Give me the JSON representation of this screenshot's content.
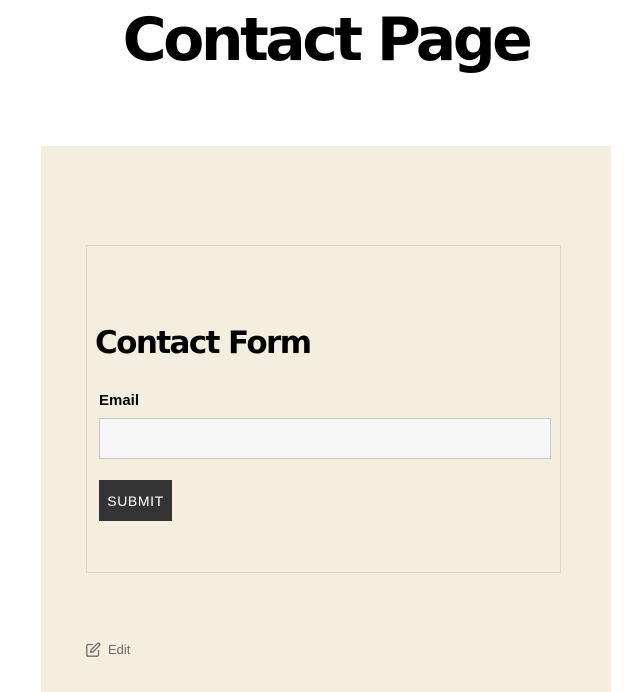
{
  "page": {
    "title": "Contact Page"
  },
  "contact_form": {
    "title": "Contact Form",
    "email_label": "Email",
    "email_value": "",
    "email_placeholder": "",
    "submit_label": "SUBMIT"
  },
  "edit": {
    "icon": "edit-pencil-icon",
    "label": "Edit"
  },
  "colors": {
    "panel_background": "#f4eedf",
    "form_border": "#dcd7c8",
    "input_background": "#f6f6f6",
    "submit_background": "#333333",
    "edit_text": "#6b6b6b"
  }
}
